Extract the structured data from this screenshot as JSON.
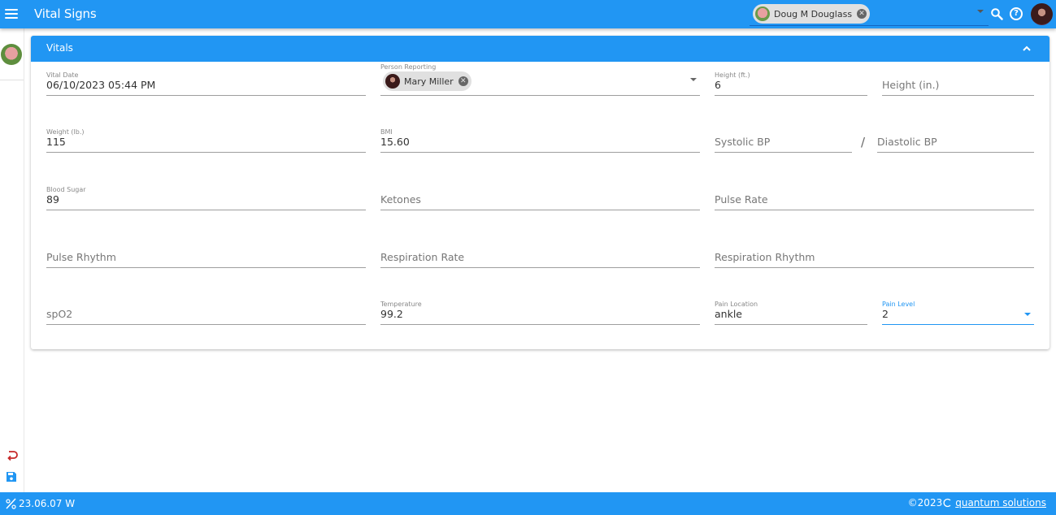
{
  "header": {
    "title": "Vital Signs",
    "patient": {
      "name": "Doug M Douglass"
    },
    "icons": [
      "menu-icon",
      "search-icon",
      "help-icon",
      "user-avatar"
    ]
  },
  "rail": {
    "icons": [
      "patient-avatar",
      "undo-icon",
      "save-icon"
    ]
  },
  "card": {
    "title": "Vitals",
    "fields": {
      "vital_date": {
        "label": "Vital Date",
        "value": "06/10/2023 05:44 PM"
      },
      "person_reporting": {
        "label": "Person Reporting",
        "value": "Mary Miller"
      },
      "height_ft": {
        "label": "Height (ft.)",
        "value": "6"
      },
      "height_in": {
        "placeholder": "Height (in.)"
      },
      "weight": {
        "label": "Weight (lb.)",
        "value": "115"
      },
      "bmi": {
        "label": "BMI",
        "value": "15.60"
      },
      "systolic": {
        "placeholder": "Systolic BP"
      },
      "bp_separator": "/",
      "diastolic": {
        "placeholder": "Diastolic BP"
      },
      "blood_sugar": {
        "label": "Blood Sugar",
        "value": "89"
      },
      "ketones": {
        "placeholder": "Ketones"
      },
      "pulse_rate": {
        "placeholder": "Pulse Rate"
      },
      "pulse_rhythm": {
        "placeholder": "Pulse Rhythm"
      },
      "respiration_rate": {
        "placeholder": "Respiration Rate"
      },
      "respiration_rhythm": {
        "placeholder": "Respiration Rhythm"
      },
      "spo2": {
        "placeholder": "spO2"
      },
      "temperature": {
        "label": "Temperature",
        "value": "99.2"
      },
      "pain_location": {
        "label": "Pain Location",
        "value": "ankle"
      },
      "pain_level": {
        "label": "Pain Level",
        "value": "2"
      }
    }
  },
  "footer": {
    "version": "23.06.07 W",
    "copyright": "©2023",
    "brand": "quantum solutions"
  },
  "colors": {
    "primary": "#2196f3",
    "undo": "#c62828"
  }
}
